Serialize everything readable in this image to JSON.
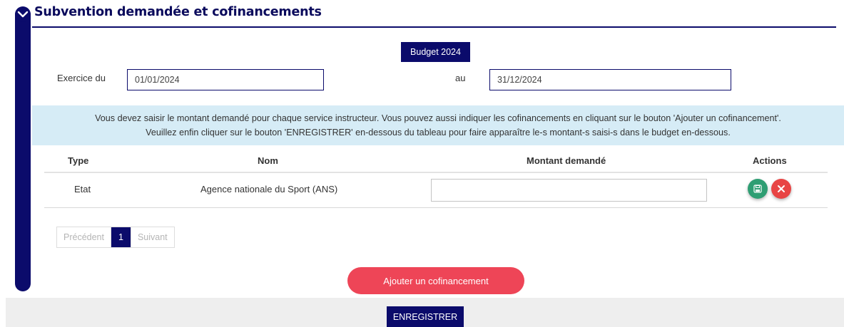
{
  "section": {
    "title": "Subvention demandée et cofinancements"
  },
  "budget": {
    "button_label": "Budget 2024"
  },
  "exercise": {
    "from_label": "Exercice du",
    "from_value": "01/01/2024",
    "to_label": "au",
    "to_value": "31/12/2024"
  },
  "info": {
    "line1": "Vous devez saisir le montant demandé pour chaque service instructeur. Vous pouvez aussi indiquer les cofinancements en cliquant sur le bouton 'Ajouter un cofinancement'.",
    "line2": "Veuillez enfin cliquer sur le bouton 'ENREGISTRER' en-dessous du tableau pour faire apparaître le-s montant-s saisi-s dans le budget en-dessous."
  },
  "table": {
    "headers": {
      "type": "Type",
      "nom": "Nom",
      "montant": "Montant demandé",
      "actions": "Actions"
    },
    "rows": [
      {
        "type": "Etat",
        "nom": "Agence nationale du Sport (ANS)",
        "montant": ""
      }
    ]
  },
  "pagination": {
    "previous": "Précédent",
    "current": "1",
    "next": "Suivant"
  },
  "buttons": {
    "add_cofinancing": "Ajouter un cofinancement",
    "save": "ENREGISTRER"
  },
  "colors": {
    "navy": "#0b0b6b",
    "info_bg": "#d6ecf6",
    "save_green": "#2f9e73",
    "delete_red": "#e84545",
    "add_button": "#ee4557"
  },
  "icons": {
    "collapse": "chevron-down-icon",
    "save_row": "floppy-disk-icon",
    "delete_row": "close-icon"
  }
}
